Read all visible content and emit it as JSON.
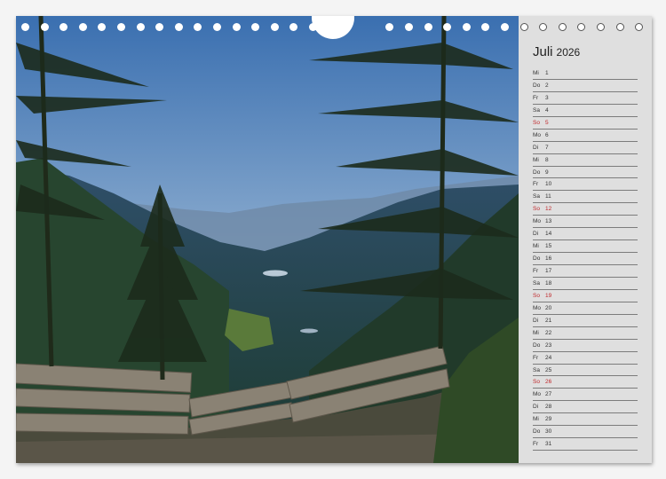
{
  "calendar": {
    "month": "Juli",
    "year": "2026",
    "days": [
      {
        "wd": "Mi",
        "d": "1"
      },
      {
        "wd": "Do",
        "d": "2"
      },
      {
        "wd": "Fr",
        "d": "3"
      },
      {
        "wd": "Sa",
        "d": "4"
      },
      {
        "wd": "So",
        "d": "5"
      },
      {
        "wd": "Mo",
        "d": "6"
      },
      {
        "wd": "Di",
        "d": "7"
      },
      {
        "wd": "Mi",
        "d": "8"
      },
      {
        "wd": "Do",
        "d": "9"
      },
      {
        "wd": "Fr",
        "d": "10"
      },
      {
        "wd": "Sa",
        "d": "11"
      },
      {
        "wd": "So",
        "d": "12"
      },
      {
        "wd": "Mo",
        "d": "13"
      },
      {
        "wd": "Di",
        "d": "14"
      },
      {
        "wd": "Mi",
        "d": "15"
      },
      {
        "wd": "Do",
        "d": "16"
      },
      {
        "wd": "Fr",
        "d": "17"
      },
      {
        "wd": "Sa",
        "d": "18"
      },
      {
        "wd": "So",
        "d": "19"
      },
      {
        "wd": "Mo",
        "d": "20"
      },
      {
        "wd": "Di",
        "d": "21"
      },
      {
        "wd": "Mi",
        "d": "22"
      },
      {
        "wd": "Do",
        "d": "23"
      },
      {
        "wd": "Fr",
        "d": "24"
      },
      {
        "wd": "Sa",
        "d": "25"
      },
      {
        "wd": "So",
        "d": "26"
      },
      {
        "wd": "Mo",
        "d": "27"
      },
      {
        "wd": "Di",
        "d": "28"
      },
      {
        "wd": "Mi",
        "d": "29"
      },
      {
        "wd": "Do",
        "d": "30"
      },
      {
        "wd": "Fr",
        "d": "31"
      }
    ]
  },
  "colors": {
    "sunday": "#c0282b",
    "sidebar": "#dfdfdf",
    "rule": "#7c7c7c"
  },
  "icons": {
    "binding": "wire-ring-binding-icon"
  }
}
